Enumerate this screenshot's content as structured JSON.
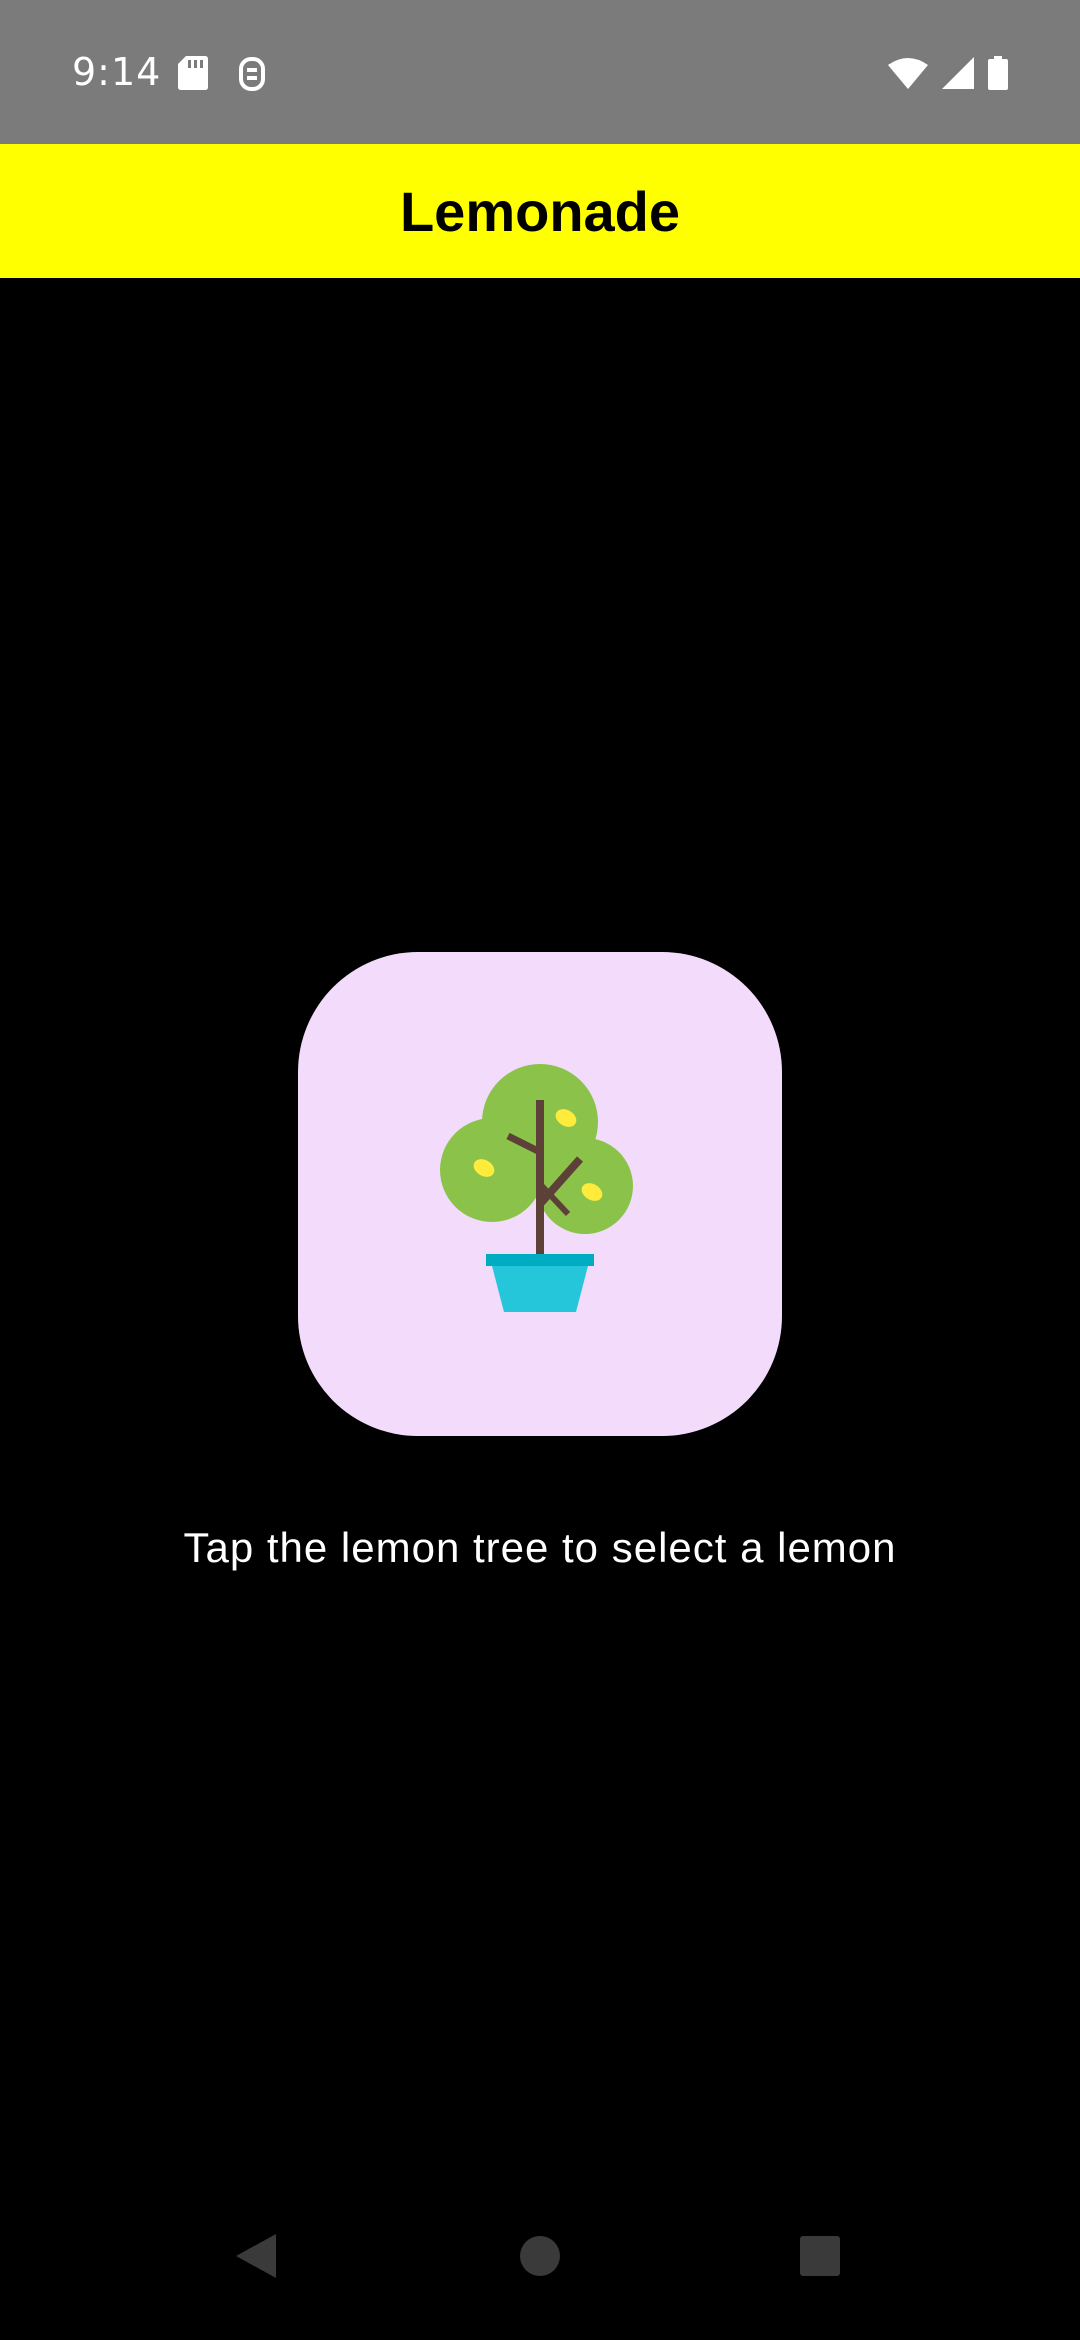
{
  "status_bar": {
    "time": "9:14",
    "icons_left": [
      "sd-card-icon",
      "debug-icon"
    ],
    "icons_right": [
      "wifi-icon",
      "cell-signal-icon",
      "battery-icon"
    ]
  },
  "app_bar": {
    "title": "Lemonade",
    "background": "#ffff00"
  },
  "main": {
    "image_button": {
      "icon": "lemon-tree-icon",
      "background": "#f3dbfb"
    },
    "instruction": "Tap the lemon tree to select a lemon"
  },
  "nav_bar": {
    "buttons": [
      "back-icon",
      "home-icon",
      "recents-icon"
    ]
  }
}
